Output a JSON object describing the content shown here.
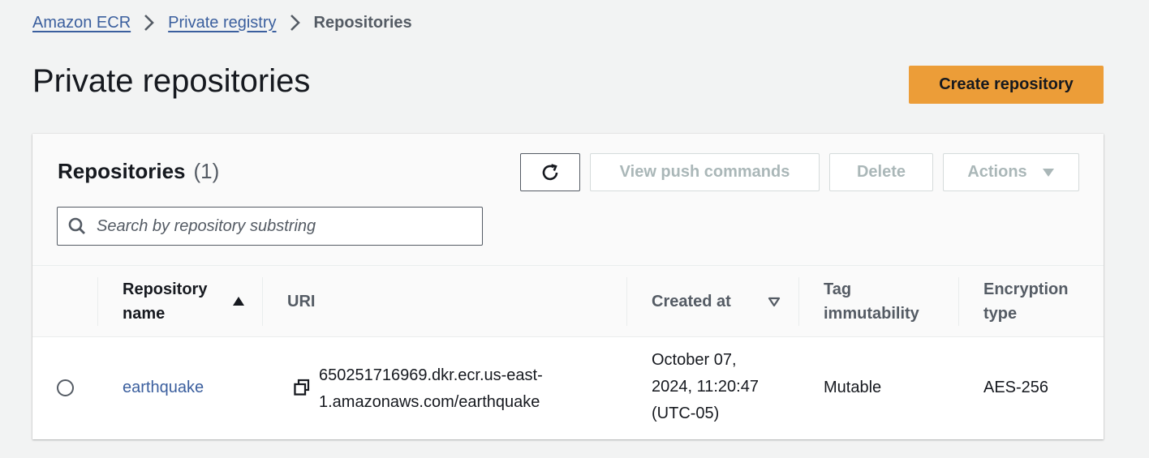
{
  "breadcrumb": {
    "items": [
      "Amazon ECR",
      "Private registry"
    ],
    "current": "Repositories"
  },
  "page": {
    "title": "Private repositories",
    "create_button": "Create repository"
  },
  "repositories_panel": {
    "title": "Repositories",
    "count": "(1)",
    "buttons": {
      "view_push": "View push commands",
      "delete": "Delete",
      "actions": "Actions"
    },
    "search": {
      "placeholder": "Search by repository substring",
      "value": ""
    }
  },
  "table": {
    "columns": {
      "name_line1": "Repository",
      "name_line2": "name",
      "uri": "URI",
      "created": "Created at",
      "tag_line1": "Tag",
      "tag_line2": "immutability",
      "enc_line1": "Encryption",
      "enc_line2": "type"
    },
    "rows": [
      {
        "name": "earthquake",
        "uri_line1": "650251716969.dkr.ecr.us-east-",
        "uri_line2": "1.amazonaws.com/earthquake",
        "created_line1": "October 07,",
        "created_line2": "2024, 11:20:47",
        "created_line3": "(UTC-05)",
        "tag_immutability": "Mutable",
        "encryption": "AES-256"
      }
    ]
  },
  "colors": {
    "accent": "#ec9d38",
    "link": "#3b5f9e",
    "background": "#f2f3f3"
  },
  "icons": {
    "breadcrumb_separator": "chevron-right-icon",
    "refresh": "refresh-icon",
    "actions_caret": "caret-down-icon",
    "search": "search-icon",
    "sort_name": "sort-ascending-icon",
    "sort_created": "sort-descending-outline-icon",
    "copy": "copy-icon"
  }
}
